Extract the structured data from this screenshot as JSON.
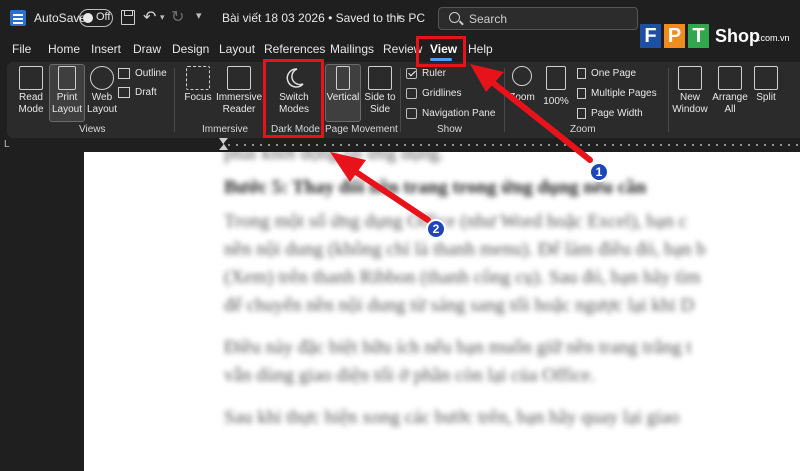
{
  "titlebar": {
    "autosave_label": "AutoSave",
    "autosave_state": "Off",
    "document_title": "Bài viết 18 03 2026 • Saved to this PC",
    "search_placeholder": "Search"
  },
  "logo": {
    "letters": [
      "F",
      "P",
      "T"
    ],
    "shop": "Shop",
    "domain": ".com.vn",
    "colors": {
      "blue": "#1e4fa3",
      "orange": "#f08b1d",
      "green": "#31a84e"
    }
  },
  "tabs": [
    "File",
    "Home",
    "Insert",
    "Draw",
    "Design",
    "Layout",
    "References",
    "Mailings",
    "Review",
    "View",
    "Help"
  ],
  "active_tab": "View",
  "ribbon": {
    "views": {
      "label": "Views",
      "read_mode": "Read Mode",
      "print_layout": "Print Layout",
      "web_layout": "Web Layout",
      "outline": "Outline",
      "draft": "Draft"
    },
    "immersive": {
      "label": "Immersive",
      "focus": "Focus",
      "immersive_reader": "Immersive Reader"
    },
    "dark_mode": {
      "label": "Dark Mode",
      "switch_modes": "Switch Modes"
    },
    "page_movement": {
      "label": "Page Movement",
      "vertical": "Vertical",
      "side_to_side": "Side to Side"
    },
    "show": {
      "label": "Show",
      "ruler": "Ruler",
      "ruler_checked": true,
      "gridlines": "Gridlines",
      "gridlines_checked": false,
      "navigation_pane": "Navigation Pane",
      "navigation_pane_checked": false
    },
    "zoom": {
      "label": "Zoom",
      "zoom_button": "Zoom",
      "hundred": "100%",
      "one_page": "One Page",
      "multiple_pages": "Multiple Pages",
      "page_width": "Page Width"
    },
    "window": {
      "new_window": "New Window",
      "arrange_all": "Arrange All",
      "split": "Split"
    }
  },
  "ruler_marker": "L",
  "document": {
    "lines": [
      "phải khởi động lại ứng dụng.",
      "Bước 5: Thay đổi nền trang trong ứng dụng nếu cần",
      "Trong một số ứng dụng Office (như Word hoặc Excel), bạn c",
      "nền nội dung (không chỉ là thanh menu). Để làm điều đó, bạn b",
      "(Xem) trên thanh Ribbon (thanh công cụ). Sau đó, bạn hãy tìm",
      "để chuyển nền nội dung từ sáng sang tối hoặc ngược lại khi D",
      "Điều này đặc biệt hữu ích nếu bạn muốn giữ nền trang trắng t",
      "vẫn dùng giao diện tối ở phần còn lại của Office.",
      "Sau khi thực hiện xong các bước trên, bạn hãy quay lại giao"
    ]
  },
  "annotations": {
    "badge_1": "1",
    "badge_2": "2",
    "highlight_color": "#e8121b",
    "badge_color": "#1d46b8"
  }
}
